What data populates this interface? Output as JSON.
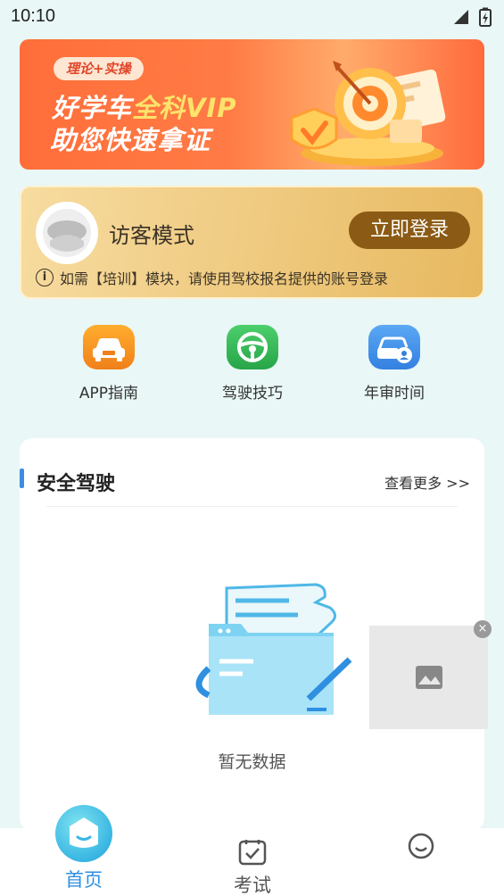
{
  "status_bar": {
    "time": "10:10"
  },
  "banner": {
    "tag": "理论+实操",
    "line1_prefix": "好学车",
    "line1_highlight": "全科VIP",
    "line2": "助您快速拿证"
  },
  "login_card": {
    "mode_label": "访客模式",
    "login_button": "立即登录",
    "info_mark": "i",
    "note": "如需【培训】模块，请使用驾校报名提供的账号登录"
  },
  "quick_links": [
    {
      "label": "APP指南",
      "icon": "car-icon",
      "color": "#f5921f"
    },
    {
      "label": "驾驶技巧",
      "icon": "steering-wheel-icon",
      "color": "#35b858"
    },
    {
      "label": "年审时间",
      "icon": "car-id-icon",
      "color": "#4a94ea"
    }
  ],
  "section": {
    "title": "安全驾驶",
    "more_link": "查看更多 >>",
    "empty_text": "暂无数据"
  },
  "ad": {
    "close_mark": "×"
  },
  "tab_bar": {
    "tabs": [
      {
        "label": "首页",
        "icon": "home-icon",
        "active": true
      },
      {
        "label": "考试",
        "icon": "exam-check-icon",
        "active": false
      },
      {
        "label": "",
        "icon": "profile-face-icon",
        "active": false
      }
    ],
    "active_color": "#2e8fe0"
  }
}
